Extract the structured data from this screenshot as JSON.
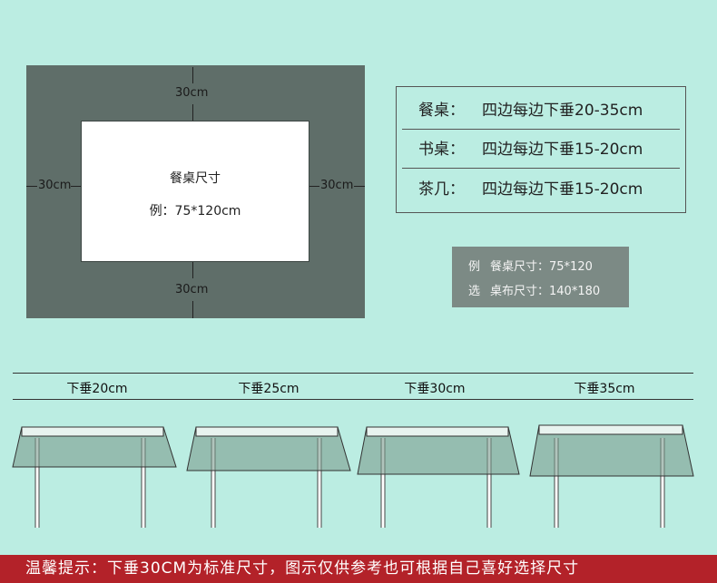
{
  "diagram": {
    "top_dim": "30cm",
    "left_dim": "30cm",
    "right_dim": "30cm",
    "bottom_dim": "30cm",
    "table_name": "餐桌尺寸",
    "table_example": "例：75*120cm"
  },
  "spec": {
    "rows": [
      {
        "name": "餐桌：",
        "desc": "四边每边下垂20-35cm"
      },
      {
        "name": "书桌：",
        "desc": "四边每边下垂15-20cm"
      },
      {
        "name": "茶几：",
        "desc": "四边每边下垂15-20cm"
      }
    ]
  },
  "example": {
    "line1_key": "例",
    "line1_val": "餐桌尺寸：75*120",
    "line2_key": "选",
    "line2_val": "桌布尺寸：140*180"
  },
  "drops": {
    "labels": [
      "下垂20cm",
      "下垂25cm",
      "下垂30cm",
      "下垂35cm"
    ]
  },
  "colors": {
    "background": "#bbede2",
    "cloth": "#5f6e69",
    "footer": "#b32229"
  },
  "footer": {
    "text": "温馨提示：下垂30CM为标准尺寸，图示仅供参考也可根据自己喜好选择尺寸"
  }
}
